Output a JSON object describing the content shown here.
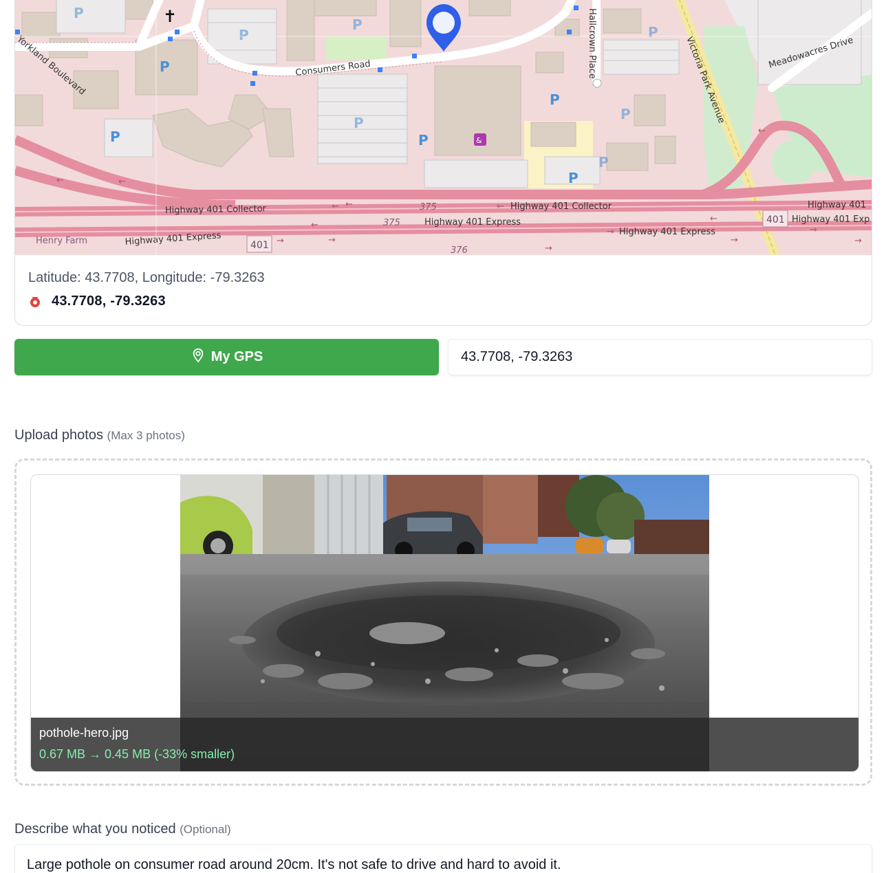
{
  "map": {
    "streets": {
      "yorkland": "Yorkland Boulevard",
      "consumers": "Consumers Road",
      "hallcrown": "Hallcrown Place",
      "victoria": "Victoria Park Avenue",
      "meadowacres": "Meadowacres Drive",
      "henry_farm": "Henry Farm",
      "hwy_collector_1": "Highway 401 Collector",
      "hwy_collector_2": "Highway 401 Collector",
      "hwy_express_1": "Highway 401 Express",
      "hwy_express_2": "Highway 401 Express",
      "hwy_express_3": "Highway 401 Express",
      "hwy_right_1": "Highway 401",
      "hwy_right_2": "Highway 401 Exp"
    },
    "shields": {
      "s375a": "375",
      "s375b": "375",
      "s376": "376",
      "s401a": "401",
      "s401b": "401"
    },
    "parking_label": "P",
    "marker_icon": "map-pin-icon"
  },
  "location": {
    "coords_text": "Latitude: 43.7708, Longitude: -79.3263",
    "coords_strong": "43.7708, -79.3263"
  },
  "controls": {
    "gps_label": "My GPS",
    "coord_value": "43.7708, -79.3263"
  },
  "upload": {
    "label": "Upload photos",
    "hint": "(Max 3 photos)",
    "file_name": "pothole-hero.jpg",
    "size_info": "0.67 MB → 0.45 MB (-33% smaller)"
  },
  "description": {
    "label": "Describe what you noticed",
    "hint": "(Optional)",
    "value": "Large pothole on consumer road around 20cm. It's not safe to drive and hard to avoid it."
  },
  "colors": {
    "gps_green": "#3fa74c",
    "highway_pink": "#e58ea0",
    "marker_blue": "#2f5ee8",
    "size_green": "#86efac"
  }
}
